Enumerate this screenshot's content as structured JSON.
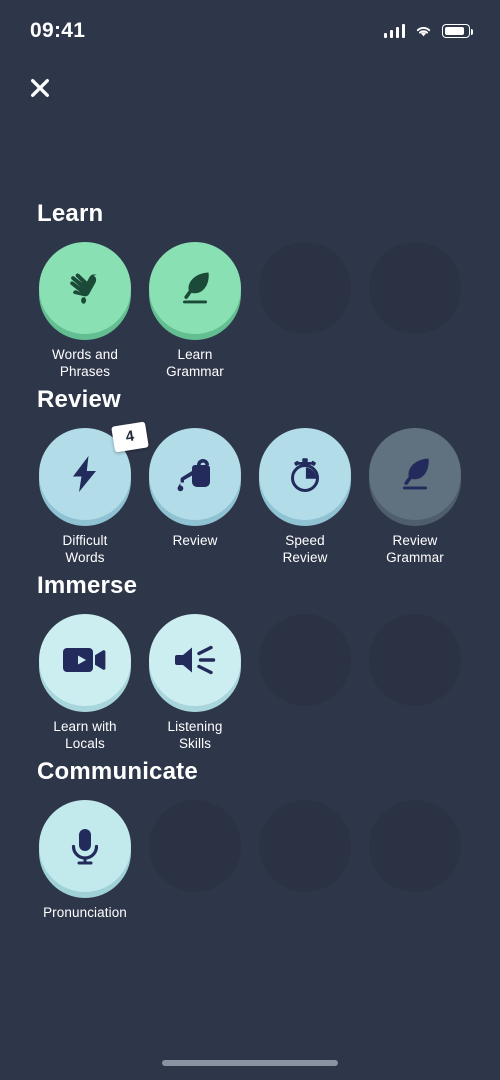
{
  "statusbar": {
    "time": "09:41",
    "signal_icon": "cellular-signal-icon",
    "wifi_icon": "wifi-icon",
    "battery_icon": "battery-icon"
  },
  "header": {
    "close_icon": "close-icon"
  },
  "colors": {
    "background": "#2e3649",
    "placeholder": "#2a3243",
    "learn_disc": "#88e0b3",
    "learn_disc_shade": "#63bf92",
    "learn_icon": "#1b4a38",
    "review_disc": "#b1dce8",
    "review_disc_shade": "#8fc2d2",
    "immerse_disc": "#cdeef1",
    "immerse_disc_shade": "#a9d5dc",
    "communicate_disc": "#c2e9ec",
    "communicate_disc_shade": "#9fd1d7",
    "disabled_disc": "#60717f",
    "disabled_disc_shade": "#4e5e6c",
    "icon_navy": "#232a5c",
    "label_text": "#ffffff",
    "badge_bg": "#ffffff",
    "badge_text": "#222a3d",
    "home_indicator": "#8b93a3"
  },
  "sections": [
    {
      "title": "Learn",
      "items": [
        {
          "label": "Words and\nPhrases",
          "icon": "sowing-hand-icon",
          "state": "active"
        },
        {
          "label": "Learn\nGrammar",
          "icon": "quill-icon",
          "state": "active"
        },
        {
          "label": "",
          "icon": "",
          "state": "placeholder"
        },
        {
          "label": "",
          "icon": "",
          "state": "placeholder"
        }
      ]
    },
    {
      "title": "Review",
      "items": [
        {
          "label": "Difficult\nWords",
          "icon": "lightning-bolt-icon",
          "state": "active",
          "badge": "4"
        },
        {
          "label": "Review",
          "icon": "watering-can-icon",
          "state": "active"
        },
        {
          "label": "Speed\nReview",
          "icon": "stopwatch-icon",
          "state": "active"
        },
        {
          "label": "Review\nGrammar",
          "icon": "quill-icon",
          "state": "disabled"
        }
      ]
    },
    {
      "title": "Immerse",
      "items": [
        {
          "label": "Learn with\nLocals",
          "icon": "video-camera-icon",
          "state": "active"
        },
        {
          "label": "Listening\nSkills",
          "icon": "speaker-icon",
          "state": "active"
        },
        {
          "label": "",
          "icon": "",
          "state": "placeholder"
        },
        {
          "label": "",
          "icon": "",
          "state": "placeholder"
        }
      ]
    },
    {
      "title": "Communicate",
      "items": [
        {
          "label": "Pronunciation",
          "icon": "microphone-icon",
          "state": "active"
        },
        {
          "label": "",
          "icon": "",
          "state": "placeholder"
        },
        {
          "label": "",
          "icon": "",
          "state": "placeholder"
        },
        {
          "label": "",
          "icon": "",
          "state": "placeholder"
        }
      ]
    }
  ]
}
